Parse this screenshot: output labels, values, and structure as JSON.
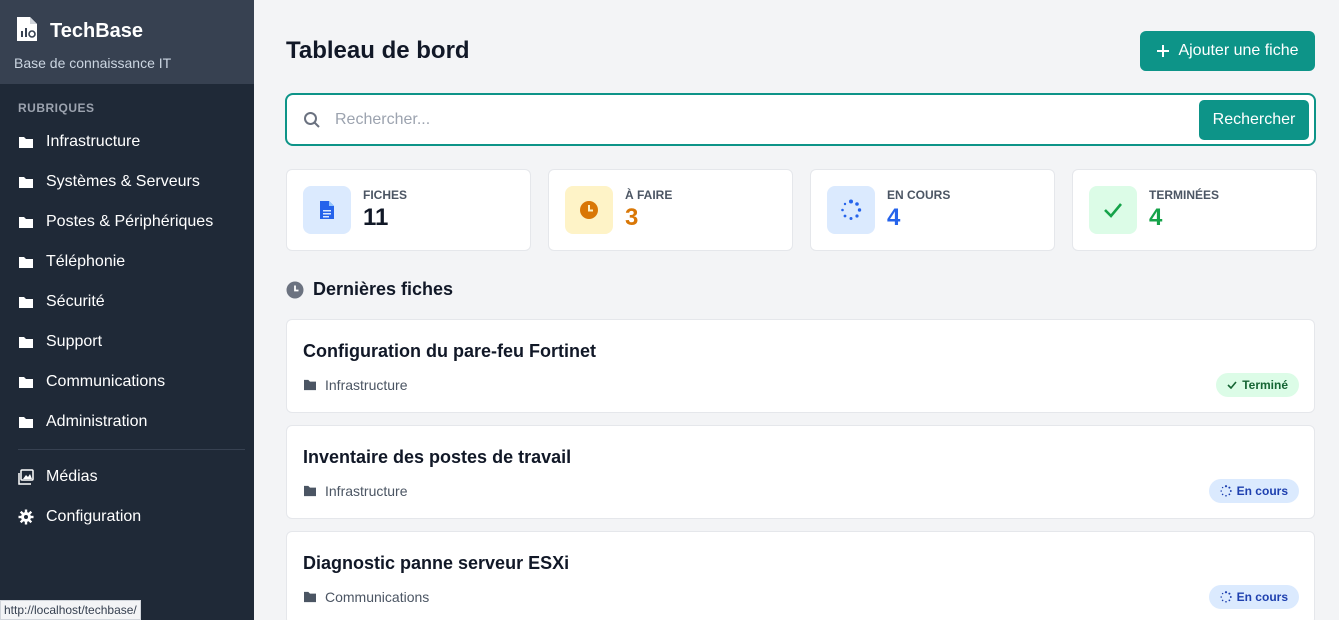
{
  "brand": {
    "title": "TechBase",
    "subtitle": "Base de connaissance IT"
  },
  "sidebar": {
    "section_label": "RUBRIQUES",
    "items": [
      {
        "label": "Infrastructure",
        "icon": "folder-icon"
      },
      {
        "label": "Systèmes & Serveurs",
        "icon": "folder-icon"
      },
      {
        "label": "Postes & Périphériques",
        "icon": "folder-icon"
      },
      {
        "label": "Téléphonie",
        "icon": "folder-icon"
      },
      {
        "label": "Sécurité",
        "icon": "folder-icon"
      },
      {
        "label": "Support",
        "icon": "folder-icon"
      },
      {
        "label": "Communications",
        "icon": "folder-icon"
      },
      {
        "label": "Administration",
        "icon": "folder-icon"
      }
    ],
    "bottom_items": [
      {
        "label": "Médias",
        "icon": "images-icon"
      },
      {
        "label": "Configuration",
        "icon": "gear-icon"
      }
    ]
  },
  "status_bar": {
    "url": "http://localhost/techbase/"
  },
  "main": {
    "title": "Tableau de bord",
    "add_button": "Ajouter une fiche",
    "search": {
      "placeholder": "Rechercher...",
      "value": "",
      "button": "Rechercher"
    },
    "stats": [
      {
        "label": "FICHES",
        "value": "11",
        "icon": "document-icon",
        "color": "#111827",
        "icon_color": "#2563eb",
        "icon_bg": "#dbeafe"
      },
      {
        "label": "À FAIRE",
        "value": "3",
        "icon": "clock-icon",
        "color": "#d97706",
        "icon_color": "#d97706",
        "icon_bg": "#fef3c7"
      },
      {
        "label": "EN COURS",
        "value": "4",
        "icon": "spinner-icon",
        "color": "#2563eb",
        "icon_color": "#2563eb",
        "icon_bg": "#dbeafe"
      },
      {
        "label": "TERMINÉES",
        "value": "4",
        "icon": "check-icon",
        "color": "#16a34a",
        "icon_color": "#16a34a",
        "icon_bg": "#dcfce7"
      }
    ],
    "recent_title": "Dernières fiches",
    "fiches": [
      {
        "title": "Configuration du pare-feu Fortinet",
        "category": "Infrastructure",
        "status": "Terminé",
        "status_type": "done"
      },
      {
        "title": "Inventaire des postes de travail",
        "category": "Infrastructure",
        "status": "En cours",
        "status_type": "progress"
      },
      {
        "title": "Diagnostic panne serveur ESXi",
        "category": "Communications",
        "status": "En cours",
        "status_type": "progress"
      }
    ]
  },
  "colors": {
    "accent": "#0d9488",
    "sidebar_bg": "#1f2937",
    "brand_bg": "#374151"
  }
}
